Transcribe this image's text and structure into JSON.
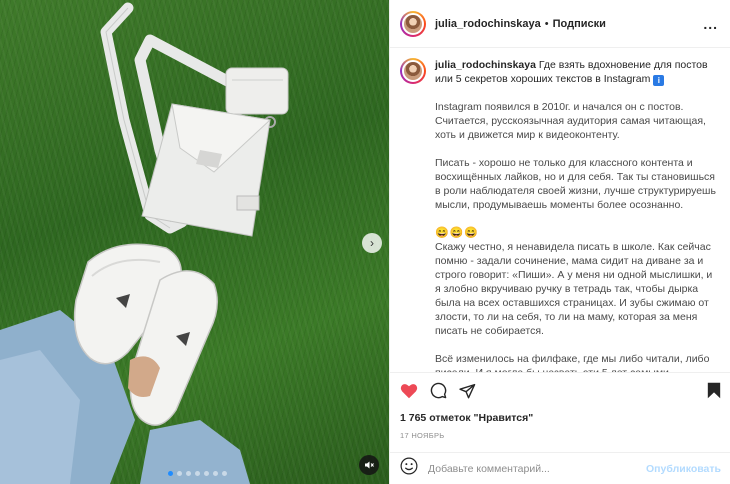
{
  "header": {
    "username": "julia_rodochinskaya",
    "separator": "•",
    "follow_label": "Подписки",
    "more_label": "..."
  },
  "caption": {
    "username": "julia_rodochinskaya",
    "title": "Где взять вдохновение для постов или 5 секретов хороших текстов в Instagram",
    "info_badge": "i",
    "paragraphs": [
      "Instagram появился в 2010г. и начался он с постов. Считается, русскоязычная аудитория самая читающая, хоть и движется мир к видеоконтенту.",
      "Писать - хорошо не только для классного контента и восхищённых лайков, но и для себя. Так ты становишься в роли наблюдателя своей жизни, лучше структурируешь мысли, продумываешь моменты более осознанно.",
      "😄😄😄",
      "Скажу честно, я ненавидела писать в школе. Как сейчас помню - задали сочинение, мама сидит на диване за и строго говорит: «Пиши». А у меня ни одной мыслишки, и я злобно вкручиваю ручку в тетрадь так, чтобы дырка была на всех оставшихся страницах. И зубы сжимаю от злости, то ли на себя, то ли на маму, которая за меня писать не собирается.",
      "Всё изменилось на филфаке, где мы либо читали, либо писали. И я могла бы назвать эти 5 лет самыми бездарными в моей жизни, если бы не приобретённый навык писать и умело выражать свои мысли."
    ]
  },
  "actions": {
    "like_icon": "heart-icon",
    "comment_icon": "comment-icon",
    "share_icon": "share-icon",
    "save_icon": "bookmark-icon",
    "like_color": "#ed4956"
  },
  "likes": "1 765 отметок \"Нравится\"",
  "date": "17 НОЯБРЬ",
  "comment": {
    "placeholder": "Добавьте комментарий...",
    "publish_label": "Опубликовать",
    "emoji_icon": "smiley-icon"
  },
  "carousel": {
    "slide_count": 7,
    "active_index": 0
  }
}
